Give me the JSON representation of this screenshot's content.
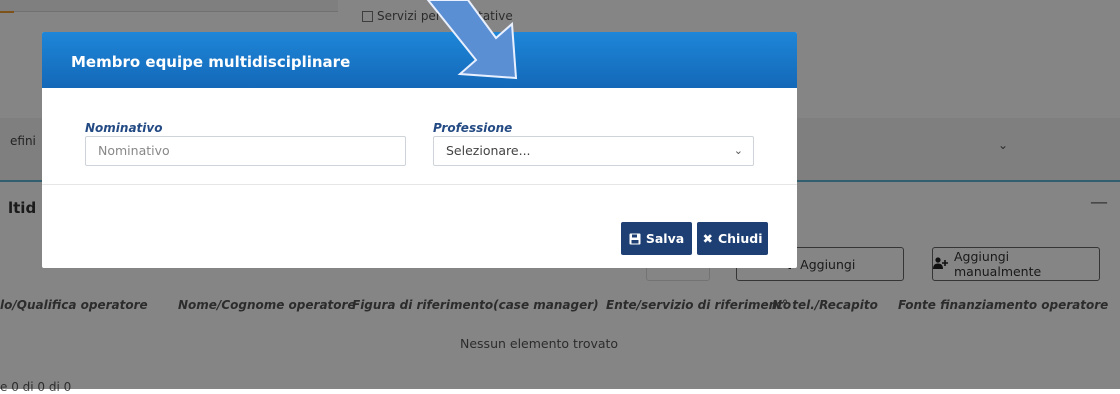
{
  "background": {
    "checkbox_label": "Servizi per ... abitative",
    "definition_label": "efini",
    "section_title": "ltid",
    "add_button_label": "Aggiungi",
    "add_manual_button_label": "Aggiungi manualmente",
    "table": {
      "columns": [
        "lo/Qualifica operatore",
        "Nome/Cognome operatore",
        "Figura di riferimento(case manager)",
        "Ente/servizio di riferimento",
        "N° tel./Recapito",
        "Fonte finanziamento operatore"
      ],
      "empty_text": "Nessun elemento trovato"
    },
    "pager_text": "e 0 di 0 di 0"
  },
  "modal": {
    "title": "Membro equipe multidisciplinare",
    "fields": {
      "nominativo": {
        "label": "Nominativo",
        "placeholder": "Nominativo"
      },
      "professione": {
        "label": "Professione",
        "selected": "Selezionare..."
      }
    },
    "buttons": {
      "save_label": "Salva",
      "close_label": "Chiudi"
    }
  },
  "colors": {
    "header_blue": "#1e86d8",
    "button_navy": "#1d3f73",
    "label_navy": "#234a83",
    "arrow_blue": "#5b8fd4"
  },
  "icons": {
    "save": "floppy-disk-icon",
    "close": "x-icon",
    "add_user": "add-user-icon",
    "chevron": "chevron-down-icon"
  }
}
